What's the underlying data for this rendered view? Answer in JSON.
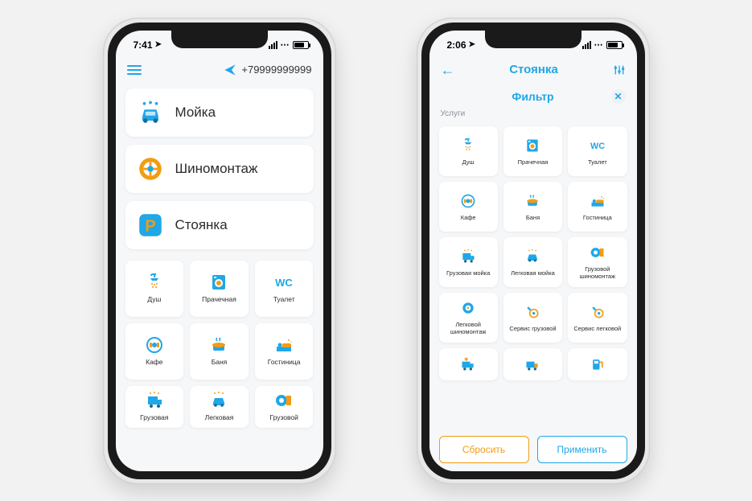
{
  "phone1": {
    "status": {
      "time": "7:41"
    },
    "header": {
      "phone_number": "+79999999999"
    },
    "categories": [
      {
        "id": "wash",
        "label": "Мойка"
      },
      {
        "id": "tire",
        "label": "Шиномонтаж"
      },
      {
        "id": "parking",
        "label": "Стоянка"
      }
    ],
    "tiles": [
      {
        "id": "shower",
        "label": "Душ"
      },
      {
        "id": "laundry",
        "label": "Прачечная"
      },
      {
        "id": "wc",
        "label": "Туалет"
      },
      {
        "id": "cafe",
        "label": "Кафе"
      },
      {
        "id": "banya",
        "label": "Баня"
      },
      {
        "id": "hotel",
        "label": "Гостиница"
      },
      {
        "id": "truckwash",
        "label": "Грузовая"
      },
      {
        "id": "carwash",
        "label": "Легковая"
      },
      {
        "id": "trucktire",
        "label": "Грузовой"
      }
    ]
  },
  "phone2": {
    "status": {
      "time": "2:06"
    },
    "header": {
      "title": "Стоянка"
    },
    "filter": {
      "title": "Фильтр",
      "section": "Услуги",
      "reset_label": "Сбросить",
      "apply_label": "Применить"
    },
    "tiles": [
      {
        "id": "shower",
        "label": "Душ"
      },
      {
        "id": "laundry",
        "label": "Прачечная"
      },
      {
        "id": "wc",
        "label": "Туалет"
      },
      {
        "id": "cafe",
        "label": "Кафе"
      },
      {
        "id": "banya",
        "label": "Баня"
      },
      {
        "id": "hotel",
        "label": "Гостиница"
      },
      {
        "id": "truckwash",
        "label": "Грузовая мойка"
      },
      {
        "id": "carwash",
        "label": "Легковая мойка"
      },
      {
        "id": "trucktire",
        "label": "Грузовой шиномонтаж"
      },
      {
        "id": "cartire",
        "label": "Легковой шиномонтаж"
      },
      {
        "id": "truckservice",
        "label": "Сервис грузовой"
      },
      {
        "id": "carservice",
        "label": "Сервис легковой"
      },
      {
        "id": "truckcold",
        "label": ""
      },
      {
        "id": "truck2",
        "label": ""
      },
      {
        "id": "fuel",
        "label": ""
      }
    ]
  }
}
